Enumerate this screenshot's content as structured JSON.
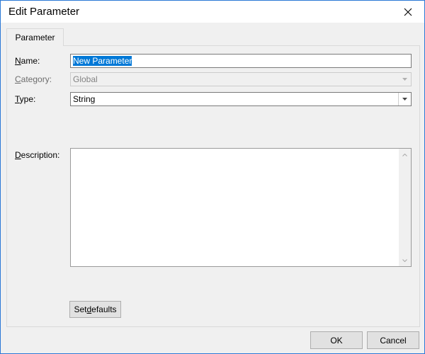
{
  "window": {
    "title": "Edit Parameter",
    "close_icon": "close-icon"
  },
  "tabs": [
    {
      "label": "Parameter",
      "active": true
    }
  ],
  "form": {
    "name": {
      "label_mnemonic": "N",
      "label_rest": "ame:",
      "value": "New Parameter"
    },
    "category": {
      "label_mnemonic": "C",
      "label_rest": "ategory:",
      "value": "Global",
      "disabled": true
    },
    "type": {
      "label_mnemonic": "T",
      "label_rest": "ype:",
      "value": "String"
    },
    "description": {
      "label_mnemonic": "D",
      "label_rest": "escription:",
      "value": ""
    }
  },
  "buttons": {
    "set_defaults": {
      "pre": "Set ",
      "mnemonic": "d",
      "post": "efaults"
    },
    "ok": "OK",
    "cancel": "Cancel"
  },
  "colors": {
    "accent": "#0078d7",
    "window_border": "#2b79d6",
    "dialog_bg": "#f0f0f0"
  }
}
